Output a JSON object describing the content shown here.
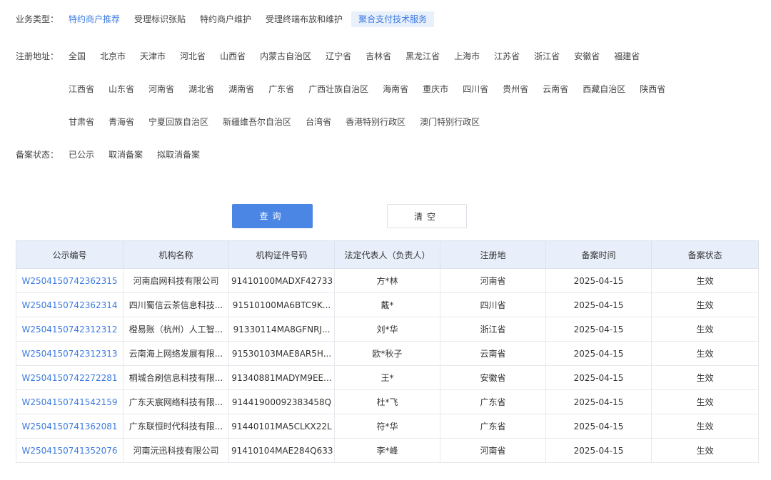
{
  "filters": {
    "business_type": {
      "label": "业务类型：",
      "options": [
        "特约商户推荐",
        "受理标识张贴",
        "特约商户维护",
        "受理终端布放和维护",
        "聚合支付技术服务"
      ]
    },
    "region": {
      "label": "注册地址：",
      "options": [
        "全国",
        "北京市",
        "天津市",
        "河北省",
        "山西省",
        "内蒙古自治区",
        "辽宁省",
        "吉林省",
        "黑龙江省",
        "上海市",
        "江苏省",
        "浙江省",
        "安徽省",
        "福建省",
        "江西省",
        "山东省",
        "河南省",
        "湖北省",
        "湖南省",
        "广东省",
        "广西壮族自治区",
        "海南省",
        "重庆市",
        "四川省",
        "贵州省",
        "云南省",
        "西藏自治区",
        "陕西省",
        "甘肃省",
        "青海省",
        "宁夏回族自治区",
        "新疆维吾尔自治区",
        "台湾省",
        "香港特别行政区",
        "澳门特别行政区"
      ]
    },
    "status": {
      "label": "备案状态：",
      "options": [
        "已公示",
        "取消备案",
        "拟取消备案"
      ]
    }
  },
  "buttons": {
    "query": "查询",
    "clear": "清空"
  },
  "table": {
    "headers": [
      "公示编号",
      "机构名称",
      "机构证件号码",
      "法定代表人（负责人）",
      "注册地",
      "备案时间",
      "备案状态"
    ],
    "rows": [
      [
        "W2504150742362315",
        "河南启网科技有限公司",
        "91410100MADXF42733",
        "方*林",
        "河南省",
        "2025-04-15",
        "生效"
      ],
      [
        "W2504150742362314",
        "四川蜀信云茶信息科技...",
        "91510100MA6BTC9K...",
        "戴*",
        "四川省",
        "2025-04-15",
        "生效"
      ],
      [
        "W2504150742312312",
        "橙易账（杭州）人工智...",
        "91330114MA8GFNRJ...",
        "刘*华",
        "浙江省",
        "2025-04-15",
        "生效"
      ],
      [
        "W2504150742312313",
        "云南海上网络发展有限...",
        "91530103MAE8AR5H...",
        "欧*秋子",
        "云南省",
        "2025-04-15",
        "生效"
      ],
      [
        "W2504150742272281",
        "桐城合刷信息科技有限...",
        "91340881MADYM9EE...",
        "王*",
        "安徽省",
        "2025-04-15",
        "生效"
      ],
      [
        "W2504150741542159",
        "广东天宸网络科技有限...",
        "91441900092383458Q",
        "杜*飞",
        "广东省",
        "2025-04-15",
        "生效"
      ],
      [
        "W2504150741362081",
        "广东联恒时代科技有限...",
        "91440101MA5CLKX22L",
        "符*华",
        "广东省",
        "2025-04-15",
        "生效"
      ],
      [
        "W2504150741352076",
        "河南沅迅科技有限公司",
        "91410104MAE284Q633",
        "李*峰",
        "河南省",
        "2025-04-15",
        "生效"
      ]
    ]
  }
}
